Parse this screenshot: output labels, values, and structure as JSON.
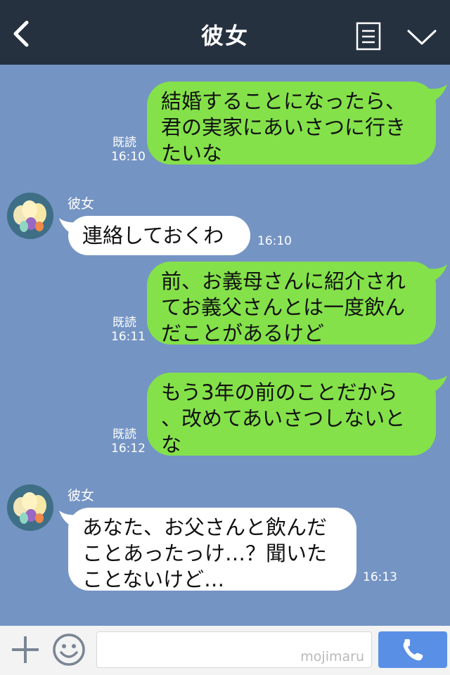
{
  "header": {
    "title": "彼女"
  },
  "messages": [
    {
      "from": "me",
      "lines": [
        "結婚することになったら、",
        "君の実家にあいさつに行き",
        "たいな"
      ],
      "read": "既読",
      "time": "16:10"
    },
    {
      "from": "them",
      "sender": "彼女",
      "lines": [
        "連絡しておくわ"
      ],
      "time": "16:10"
    },
    {
      "from": "me",
      "lines": [
        "前、お義母さんに紹介され",
        "てお義父さんとは一度飲ん",
        "だことがあるけど"
      ],
      "read": "既読",
      "time": "16:11"
    },
    {
      "from": "me",
      "lines": [
        "もう3年の前のことだから",
        "、改めてあいさつしないと",
        "な"
      ],
      "read": "既読",
      "time": "16:12"
    },
    {
      "from": "them",
      "sender": "彼女",
      "lines": [
        "あなた、お父さんと飲んだ",
        "ことあったっけ…？聞いた",
        "ことないけど…"
      ],
      "time": "16:13"
    }
  ],
  "footer": {
    "watermark": "mojimaru"
  },
  "colors": {
    "header": "#263140",
    "chat_bg": "#7494c3",
    "my_bubble": "#84e14a",
    "their_bubble": "#ffffff",
    "call_button": "#5a8fe6"
  },
  "icons": {
    "back": "chevron-left-icon",
    "menu": "list-icon",
    "collapse": "chevron-down-icon",
    "plus": "plus-icon",
    "emoji": "smiley-icon",
    "call": "phone-icon"
  }
}
